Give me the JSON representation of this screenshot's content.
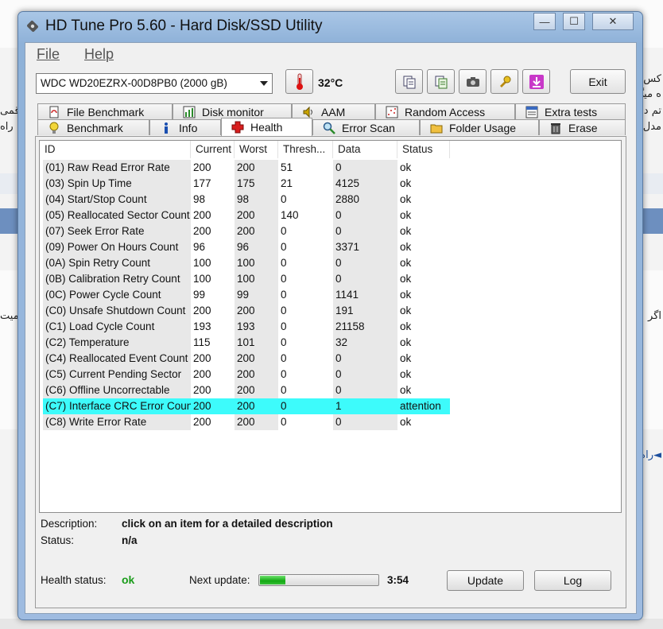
{
  "window": {
    "title": "HD Tune Pro 5.60 - Hard Disk/SSD Utility",
    "minimize": "—",
    "maximize": "☐",
    "close": "✕"
  },
  "menu": {
    "file": "File",
    "help": "Help"
  },
  "toolbar": {
    "drive": "WDC WD20EZRX-00D8PB0 (2000 gB)",
    "temperature": "32°C",
    "exit": "Exit"
  },
  "tabs": {
    "top": [
      "File Benchmark",
      "Disk monitor",
      "AAM",
      "Random Access",
      "Extra tests"
    ],
    "bottom": [
      "Benchmark",
      "Info",
      "Health",
      "Error Scan",
      "Folder Usage",
      "Erase"
    ]
  },
  "table": {
    "columns": [
      "ID",
      "Current",
      "Worst",
      "Thresh...",
      "Data",
      "Status"
    ],
    "rows": [
      [
        "(01) Raw Read Error Rate",
        "200",
        "200",
        "51",
        "0",
        "ok"
      ],
      [
        "(03) Spin Up Time",
        "177",
        "175",
        "21",
        "4125",
        "ok"
      ],
      [
        "(04) Start/Stop Count",
        "98",
        "98",
        "0",
        "2880",
        "ok"
      ],
      [
        "(05) Reallocated Sector Count",
        "200",
        "200",
        "140",
        "0",
        "ok"
      ],
      [
        "(07) Seek Error Rate",
        "200",
        "200",
        "0",
        "0",
        "ok"
      ],
      [
        "(09) Power On Hours Count",
        "96",
        "96",
        "0",
        "3371",
        "ok"
      ],
      [
        "(0A) Spin Retry Count",
        "100",
        "100",
        "0",
        "0",
        "ok"
      ],
      [
        "(0B) Calibration Retry Count",
        "100",
        "100",
        "0",
        "0",
        "ok"
      ],
      [
        "(0C) Power Cycle Count",
        "99",
        "99",
        "0",
        "1141",
        "ok"
      ],
      [
        "(C0) Unsafe Shutdown Count",
        "200",
        "200",
        "0",
        "191",
        "ok"
      ],
      [
        "(C1) Load Cycle Count",
        "193",
        "193",
        "0",
        "21158",
        "ok"
      ],
      [
        "(C2) Temperature",
        "115",
        "101",
        "0",
        "32",
        "ok"
      ],
      [
        "(C4) Reallocated Event Count",
        "200",
        "200",
        "0",
        "0",
        "ok"
      ],
      [
        "(C5) Current Pending Sector",
        "200",
        "200",
        "0",
        "0",
        "ok"
      ],
      [
        "(C6) Offline Uncorrectable",
        "200",
        "200",
        "0",
        "0",
        "ok"
      ],
      [
        "(C7) Interface CRC Error Count",
        "200",
        "200",
        "0",
        "1",
        "attention"
      ],
      [
        "(C8) Write Error Rate",
        "200",
        "200",
        "0",
        "0",
        "ok"
      ]
    ],
    "highlight_status": "attention",
    "highlight_color": "#3dfbfb"
  },
  "details": {
    "description_label": "Description:",
    "description_value": "click on an item for a detailed description",
    "status_label": "Status:",
    "status_value": "n/a"
  },
  "footer": {
    "health_label": "Health status:",
    "health_value": "ok",
    "next_update_label": "Next update:",
    "progress": 0.21,
    "countdown": "3:54",
    "update_button": "Update",
    "log_button": "Log"
  },
  "background": {
    "snippets": [
      "کس",
      "ه میگ",
      "قمی",
      "تم د",
      "راه",
      "مدل",
      "میت",
      "اگر",
      "◄راه"
    ]
  }
}
